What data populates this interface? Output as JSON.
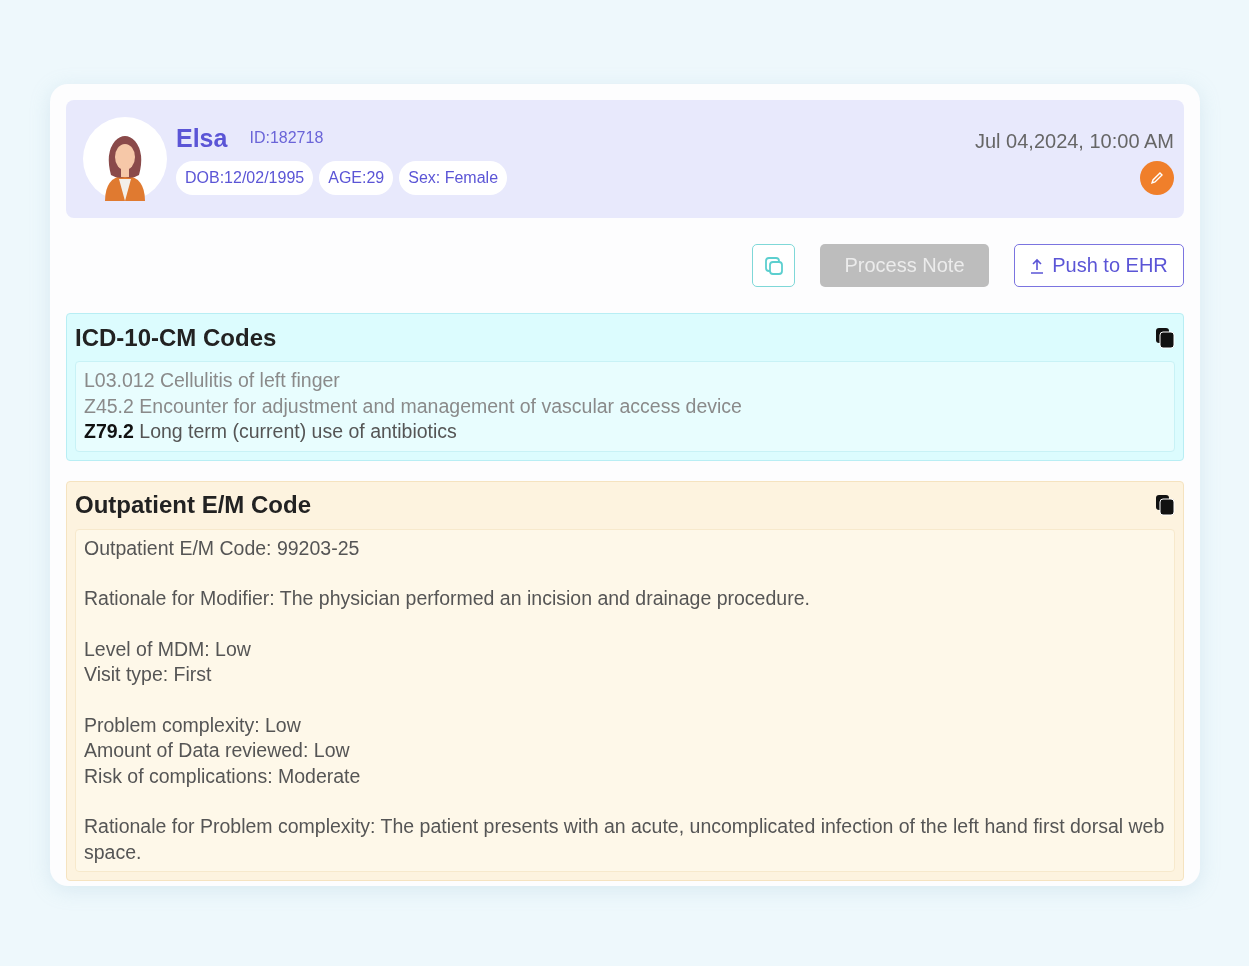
{
  "patient": {
    "name": "Elsa",
    "id": "ID:182718",
    "chips": [
      "DOB:12/02/1995",
      "AGE:29",
      "Sex: Female"
    ],
    "datetime": "Jul 04,2024, 10:00 AM"
  },
  "toolbar": {
    "buttons": [
      {
        "kind": "copy",
        "disabled": false
      },
      {
        "kind": "text",
        "label": "Process Note",
        "disabled": true
      },
      {
        "kind": "upload",
        "label": "Push to EHR",
        "disabled": false
      }
    ]
  },
  "sections": [
    {
      "title": "ICD-10-CM Codes",
      "kind": "codes",
      "blocks": [
        [
          {
            "text": "L03.012 Cellulitis of left finger",
            "muted": true
          },
          {
            "text": "Z45.2 Encounter for adjustment and management of vascular access device",
            "muted": true
          },
          {
            "text": "**Z79.2** Long term (current) use of antibiotics",
            "muted": false
          }
        ]
      ]
    },
    {
      "title": "Outpatient E/M Code",
      "kind": "visit",
      "blocks": [
        [
          {
            "text": "Outpatient E/M Code: 99203-25",
            "muted": false
          }
        ],
        [
          {
            "text": "Rationale for Modifier: The physician performed an incision and drainage procedure.",
            "muted": false
          }
        ],
        [
          {
            "text": "Level of MDM: Low",
            "muted": false
          },
          {
            "text": "Visit type: First",
            "muted": false
          }
        ],
        [
          {
            "text": "Problem complexity: Low",
            "muted": false
          },
          {
            "text": "Amount of Data reviewed: Low",
            "muted": false
          },
          {
            "text": "Risk of complications: Moderate",
            "muted": false
          }
        ],
        [
          {
            "text": "Rationale for Problem complexity: The patient presents with an acute, uncomplicated infection of the left hand first dorsal web space.",
            "muted": false
          }
        ]
      ]
    }
  ]
}
